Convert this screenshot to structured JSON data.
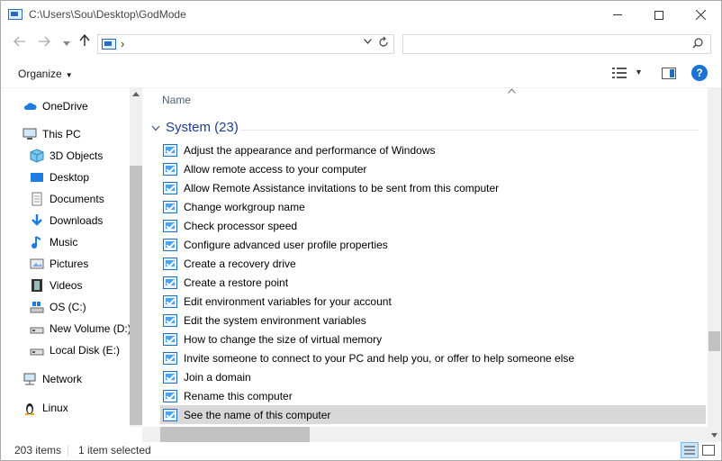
{
  "window": {
    "title": "C:\\Users\\Sou\\Desktop\\GodMode"
  },
  "address": {
    "separator": "›",
    "search_placeholder": ""
  },
  "ribbon": {
    "organize_label": "Organize"
  },
  "navigation": {
    "items": [
      {
        "label": "OneDrive",
        "icon": "cloud-icon"
      },
      {
        "label": "This PC",
        "icon": "computer-icon"
      },
      {
        "label": "3D Objects",
        "icon": "cube-icon"
      },
      {
        "label": "Desktop",
        "icon": "desktop-icon"
      },
      {
        "label": "Documents",
        "icon": "document-icon"
      },
      {
        "label": "Downloads",
        "icon": "download-icon"
      },
      {
        "label": "Music",
        "icon": "music-icon"
      },
      {
        "label": "Pictures",
        "icon": "pictures-icon"
      },
      {
        "label": "Videos",
        "icon": "video-icon"
      },
      {
        "label": "OS (C:)",
        "icon": "drive-icon"
      },
      {
        "label": "New Volume (D:)",
        "icon": "drive-icon"
      },
      {
        "label": "Local Disk (E:)",
        "icon": "drive-icon"
      },
      {
        "label": "Network",
        "icon": "network-icon"
      },
      {
        "label": "Linux",
        "icon": "linux-icon"
      }
    ]
  },
  "content": {
    "column_name": "Name",
    "group_title": "System (23)",
    "items": [
      "Adjust the appearance and performance of Windows",
      "Allow remote access to your computer",
      "Allow Remote Assistance invitations to be sent from this computer",
      "Change workgroup name",
      "Check processor speed",
      "Configure advanced user profile properties",
      "Create a recovery drive",
      "Create a restore point",
      "Edit environment variables for your account",
      "Edit the system environment variables",
      "How to change the size of virtual memory",
      "Invite someone to connect to your PC and help you, or offer to help someone else",
      "Join a domain",
      "Rename this computer",
      "See the name of this computer"
    ],
    "selected_index": 14
  },
  "status": {
    "item_count": "203 items",
    "selection": "1 item selected"
  },
  "colors": {
    "accent": "#1a73d4",
    "group_header": "#1e3f8e",
    "selection": "#d9d9d9"
  }
}
